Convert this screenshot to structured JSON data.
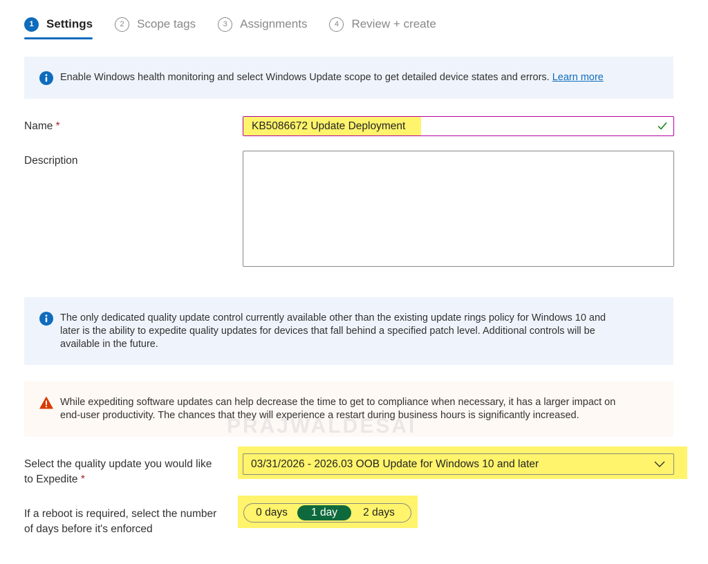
{
  "wizard": {
    "steps": [
      {
        "num": "1",
        "label": "Settings"
      },
      {
        "num": "2",
        "label": "Scope tags"
      },
      {
        "num": "3",
        "label": "Assignments"
      },
      {
        "num": "4",
        "label": "Review + create"
      }
    ]
  },
  "banner_health": {
    "text": "Enable Windows health monitoring and select Windows Update scope to get detailed device states and errors. ",
    "link": "Learn more"
  },
  "form": {
    "name_label": "Name",
    "required_mark": "*",
    "name_value": "KB5086672 Update Deployment",
    "description_label": "Description",
    "description_value": "",
    "quality_label_line1": "Select the quality update you would like",
    "quality_label_line2": "to Expedite",
    "quality_value": "03/31/2026 - 2026.03 OOB Update for Windows 10 and later",
    "reboot_label_line1": "If a reboot is required, select the number",
    "reboot_label_line2": "of days before it's enforced",
    "reboot_options": [
      "0 days",
      "1 day",
      "2 days"
    ],
    "reboot_selected": "1 day"
  },
  "banner_quality": {
    "line1": "The only dedicated quality update control currently available other than the existing update rings policy for Windows 10 and",
    "line2": "later is the ability to expedite quality updates for devices that fall behind a specified patch level. Additional controls will be",
    "line3": "available in the future."
  },
  "banner_warning": {
    "line1": "While expediting software updates can help decrease the time to get to compliance when necessary, it has a larger impact on",
    "line2": "end-user productivity. The chances that they will experience a restart during business hours is significantly increased."
  },
  "watermark": "PRAJWALDESAI",
  "icons": {
    "info": "info-icon",
    "warning": "warning-icon",
    "check": "check-icon",
    "chevron": "chevron-down-icon"
  },
  "colors": {
    "accent": "#0f6cbd",
    "highlight": "#fff46b",
    "selected_pill": "#0e6a3d",
    "required": "#a4262c",
    "warning": "#d83b01"
  }
}
